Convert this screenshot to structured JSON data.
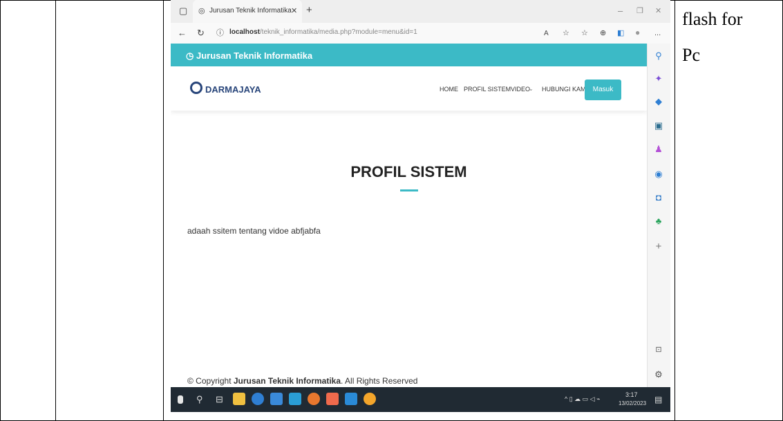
{
  "document": {
    "side_text": [
      "flash for",
      "Pc"
    ]
  },
  "browser": {
    "tab_title": "Jurusan Teknik Informatika",
    "url_host": "localhost",
    "url_path": "/teknik_informatika/media.php?module=menu&id=1",
    "read_aloud": "A",
    "more": "..."
  },
  "site": {
    "topbar_text": "Jurusan Teknik Informatika",
    "logo_text": "DARMAJAYA",
    "nav": [
      "HOME",
      "PROFIL SISTEM",
      "VIDEO",
      "HUBUNGI KAMI"
    ],
    "login_button": "Masuk",
    "page_title": "PROFIL SISTEM",
    "content": "adaah ssitem tentang vidoe abfjabfa",
    "copyright_prefix": "© Copyright ",
    "copyright_brand": "Jurusan Teknik Informatika",
    "copyright_suffix": ". All Rights Reserved"
  },
  "taskbar": {
    "time": "3:17",
    "date": "13/02/2023"
  },
  "colors": {
    "accent": "#3cbac6",
    "brand": "#28457a",
    "taskbar": "#202a33"
  },
  "icons": [
    "window-icon",
    "tab-favicon-icon",
    "close-icon",
    "new-tab-icon",
    "back-icon",
    "refresh-icon",
    "info-icon",
    "favorites-icon",
    "collections-icon",
    "search-icon",
    "settings-icon"
  ]
}
